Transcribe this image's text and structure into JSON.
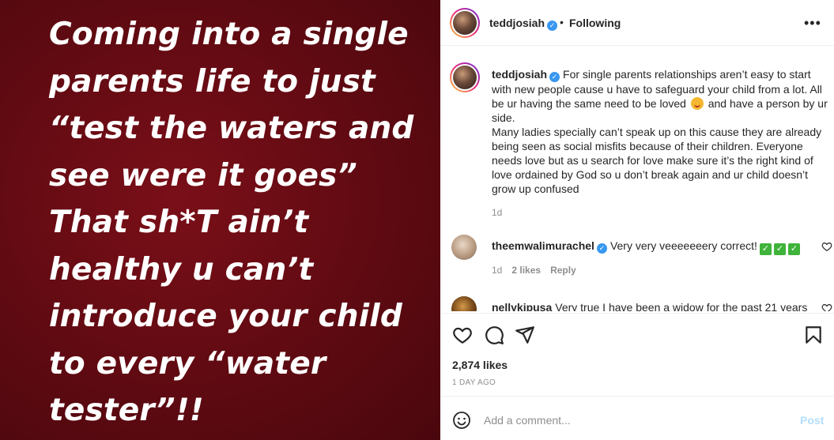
{
  "media": {
    "text": "Coming into a single parents life to just “test the waters and see were it goes” That sh*T ain’t healthy u can’t introduce your child to every “water tester”!!"
  },
  "header": {
    "username": "teddjosiah",
    "dot": "•",
    "following": "Following",
    "more": "•••"
  },
  "caption": {
    "username": "teddjosiah",
    "text_part1": "For single parents relationships aren’t easy to start with new people cause u have to safeguard your child from a lot. All be ur having the same need to be loved",
    "text_part2": " and have a person by ur side.\nMany ladies specially can’t speak up on this cause they are already being seen as social misfits because of their children. Everyone needs love but as u search for love make sure it’s the right kind of love ordained by God so u don’t break again and ur child doesn’t grow up confused",
    "time": "1d"
  },
  "comments": [
    {
      "username": "theemwalimurachel",
      "text": "Very very veeeeeeery correct!",
      "check": "✓",
      "time": "1d",
      "likes": "2 likes",
      "reply": "Reply"
    },
    {
      "username": "nellykipusa",
      "text": "Very true I have been a widow for the past 21 years"
    }
  ],
  "actions": {
    "likes": "2,874 likes",
    "date": "1 DAY AGO"
  },
  "add_comment": {
    "placeholder": "Add a comment...",
    "post": "Post"
  },
  "colors": {
    "media_background": "#5f0a12",
    "verified": "#3897f0",
    "post_disabled": "#b2dffc",
    "check": "#3fb33a"
  }
}
